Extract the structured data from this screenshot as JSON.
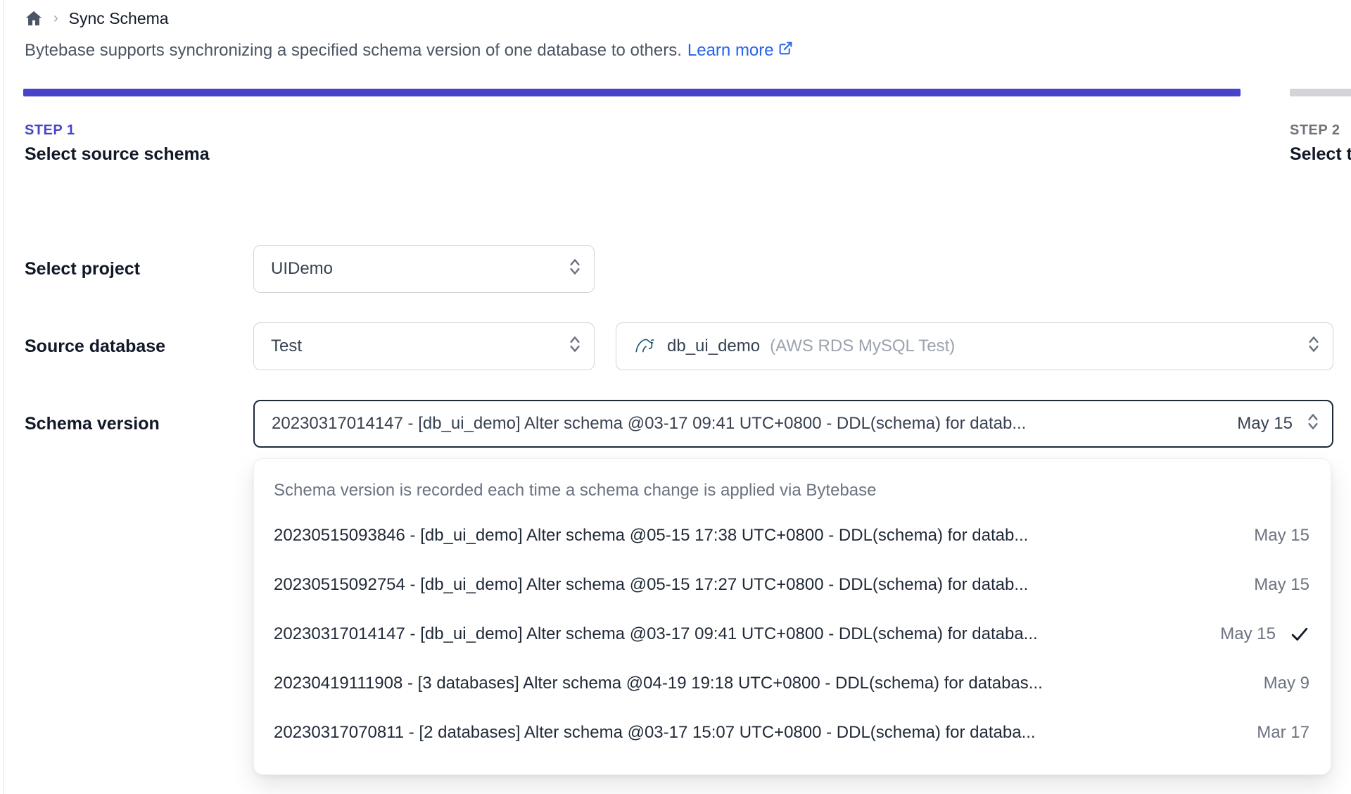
{
  "breadcrumb": {
    "page_title": "Sync Schema",
    "separator": "›"
  },
  "description": {
    "text": "Bytebase supports synchronizing a specified schema version of one database to others.",
    "link_label": "Learn more"
  },
  "steps": [
    {
      "step": "STEP 1",
      "title": "Select source schema",
      "state": "active"
    },
    {
      "step": "STEP 2",
      "title": "Select t",
      "state": "inactive"
    }
  ],
  "form": {
    "project": {
      "label": "Select project",
      "value": "UIDemo"
    },
    "source_database": {
      "label": "Source database",
      "environment_value": "Test",
      "database_name": "db_ui_demo",
      "database_detail": "(AWS RDS MySQL Test)"
    },
    "schema_version": {
      "label": "Schema version",
      "value": "20230317014147 - [db_ui_demo] Alter schema @03-17 09:41 UTC+0800 - DDL(schema) for datab...",
      "date": "May 15"
    }
  },
  "dropdown": {
    "note": "Schema version is recorded each time a schema change is applied via Bytebase",
    "options": [
      {
        "text": "20230515093846 - [db_ui_demo] Alter schema @05-15 17:38 UTC+0800 - DDL(schema) for datab...",
        "date": "May 15",
        "selected": false
      },
      {
        "text": "20230515092754 - [db_ui_demo] Alter schema @05-15 17:27 UTC+0800 - DDL(schema) for datab...",
        "date": "May 15",
        "selected": false
      },
      {
        "text": "20230317014147 - [db_ui_demo] Alter schema @03-17 09:41 UTC+0800 - DDL(schema) for databa...",
        "date": "May 15",
        "selected": true
      },
      {
        "text": "20230419111908 - [3 databases] Alter schema @04-19 19:18 UTC+0800 - DDL(schema) for databas...",
        "date": "May 9",
        "selected": false
      },
      {
        "text": "20230317070811 - [2 databases] Alter schema @03-17 15:07 UTC+0800 - DDL(schema) for databa...",
        "date": "Mar 17",
        "selected": false
      }
    ]
  },
  "colors": {
    "accent_indigo": "#4744cb",
    "link_blue": "#2563eb",
    "inactive_bar_gray": "#d4d4d8"
  }
}
